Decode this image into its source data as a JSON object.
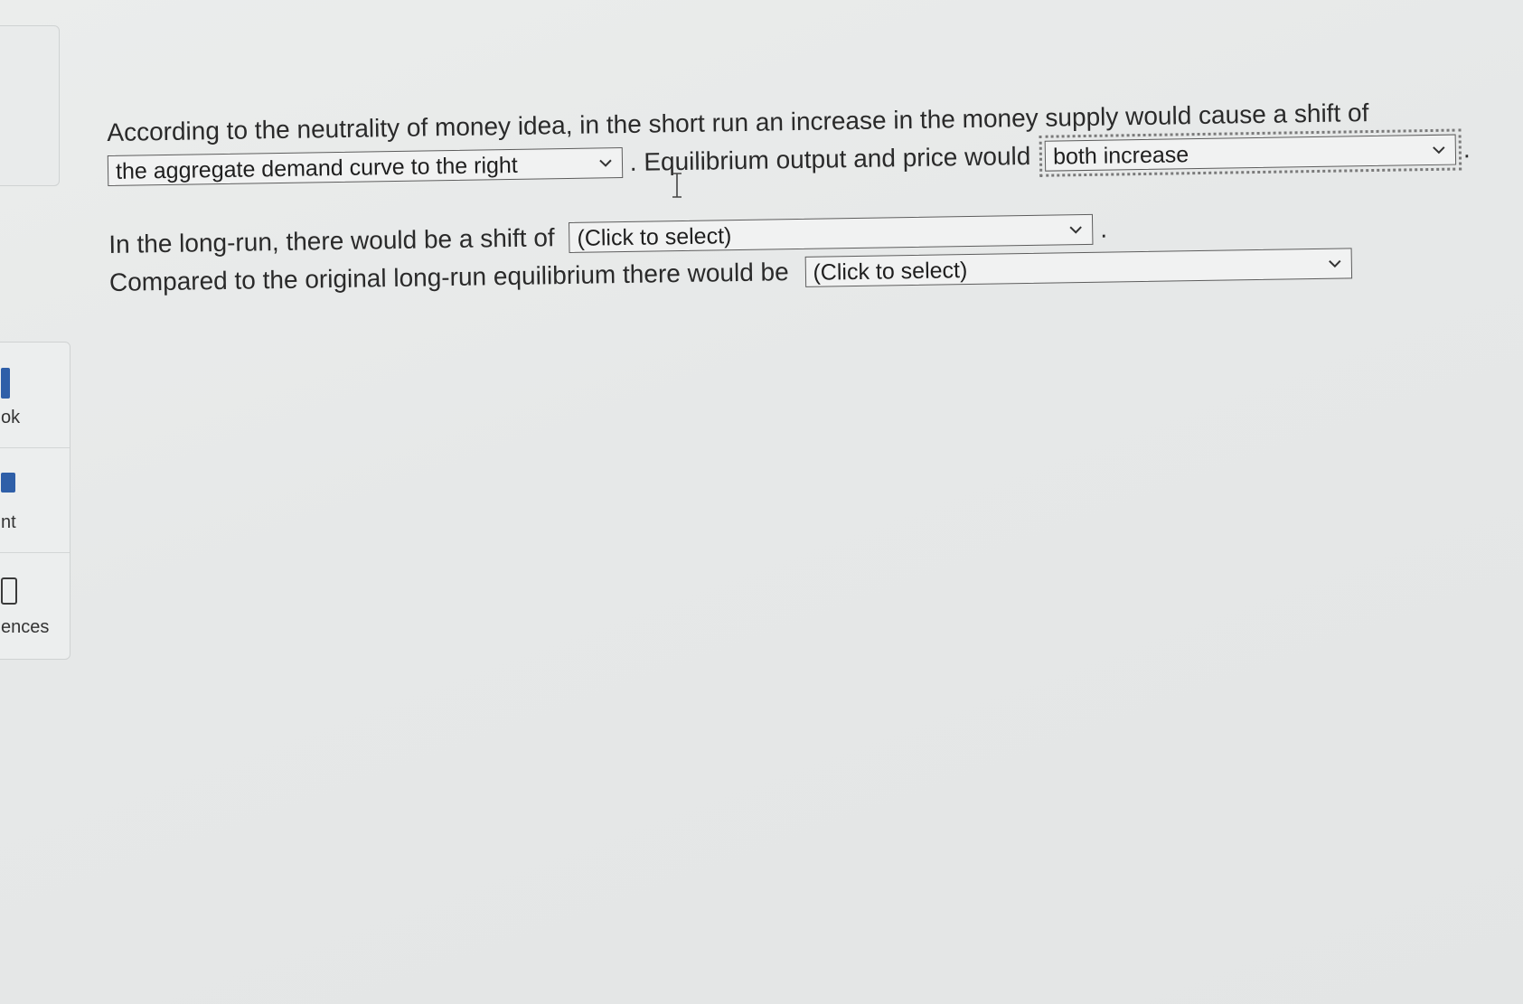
{
  "sidebar": {
    "tools": [
      {
        "label": "ok",
        "icon": "book-icon"
      },
      {
        "label": "nt",
        "icon": "print-icon"
      },
      {
        "label": "ences",
        "icon": "references-icon"
      }
    ]
  },
  "question": {
    "line1_text": "According to the neutrality of money idea, in the short run an increase in the money supply would cause a shift of",
    "dropdown1_value": "the aggregate demand curve to the right",
    "line2_text": ". Equilibrium output and price would",
    "dropdown2_value": "both increase",
    "line2_end": ".",
    "line3_text": "In the long-run, there would be a shift of",
    "dropdown3_value": "(Click to select)",
    "line3_end": ".",
    "line4_text": "Compared to the original long-run equilibrium there would be",
    "dropdown4_value": "(Click to select)"
  }
}
